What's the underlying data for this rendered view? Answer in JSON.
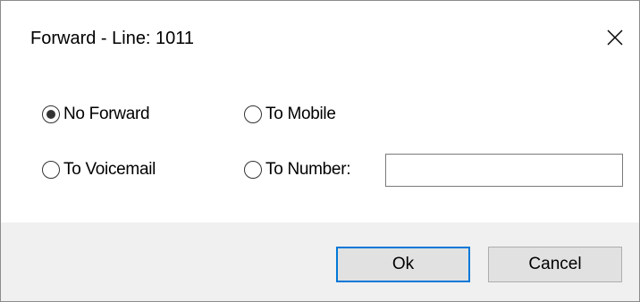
{
  "dialog": {
    "title": "Forward - Line: 1011",
    "close_icon": "close-icon"
  },
  "options": {
    "no_forward": {
      "label": "No Forward",
      "selected": true
    },
    "to_mobile": {
      "label": "To Mobile",
      "selected": false
    },
    "to_voicemail": {
      "label": "To Voicemail",
      "selected": false
    },
    "to_number": {
      "label": "To Number:",
      "selected": false
    }
  },
  "number_input": {
    "value": ""
  },
  "buttons": {
    "ok_label": "Ok",
    "cancel_label": "Cancel"
  },
  "colors": {
    "footer_background": "#f0f0f0",
    "default_button_border": "#0078d7",
    "button_face": "#e1e1e1"
  }
}
